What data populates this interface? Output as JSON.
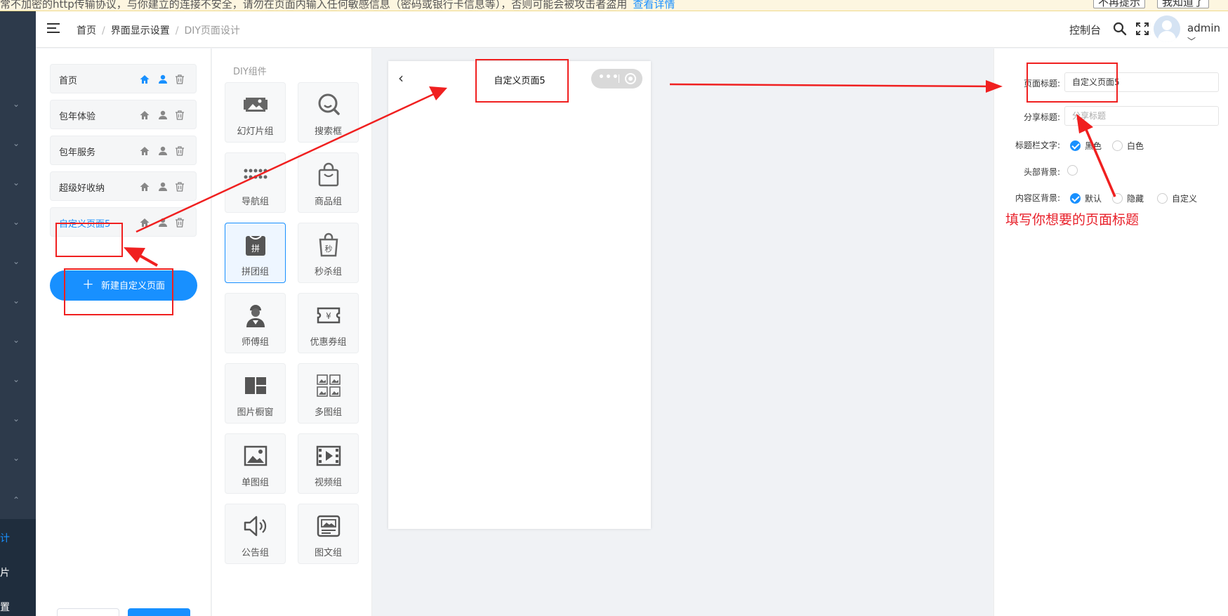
{
  "banner": {
    "text": "常不加密的http传输协议，与你建立的连接不安全，请勿在页面内输入任何敏感信息（密码或银行卡信息等），否则可能会被攻击者盗用",
    "link": "查看详情",
    "btn_no_remind": "不再提示",
    "btn_know": "我知道了"
  },
  "sidebar": {
    "items": [
      "计",
      "片",
      "置"
    ]
  },
  "header": {
    "breadcrumb": [
      "首页",
      "界面显示设置",
      "DIY页面设计"
    ],
    "console": "控制台",
    "user": "admin"
  },
  "pages": {
    "items": [
      {
        "label": "首页",
        "is_home": true
      },
      {
        "label": "包年体验",
        "is_home": false
      },
      {
        "label": "包年服务",
        "is_home": false
      },
      {
        "label": "超级好收纳",
        "is_home": false
      },
      {
        "label": "自定义页面5",
        "is_home": false
      }
    ],
    "new_button": "新建自定义页面"
  },
  "palette": {
    "title": "DIY组件",
    "components": [
      {
        "label": "幻灯片组",
        "icon": "slideshow-icon"
      },
      {
        "label": "搜索框",
        "icon": "search-icon"
      },
      {
        "label": "导航组",
        "icon": "nav-grid-icon"
      },
      {
        "label": "商品组",
        "icon": "shopping-bag-icon"
      },
      {
        "label": "拼团组",
        "icon": "group-buy-icon"
      },
      {
        "label": "秒杀组",
        "icon": "flash-sale-icon"
      },
      {
        "label": "师傅组",
        "icon": "worker-icon"
      },
      {
        "label": "优惠券组",
        "icon": "coupon-icon"
      },
      {
        "label": "图片橱窗",
        "icon": "image-window-icon"
      },
      {
        "label": "多图组",
        "icon": "multi-image-icon"
      },
      {
        "label": "单图组",
        "icon": "single-image-icon"
      },
      {
        "label": "视频组",
        "icon": "video-icon"
      },
      {
        "label": "公告组",
        "icon": "announcement-icon"
      },
      {
        "label": "图文组",
        "icon": "image-text-icon"
      }
    ]
  },
  "preview": {
    "title": "自定义页面5"
  },
  "settings": {
    "page_title_label": "页面标题:",
    "page_title_value": "自定义页面5",
    "share_title_label": "分享标题:",
    "share_title_placeholder": "分享标题",
    "titlebar_text_label": "标题栏文字:",
    "titlebar_options": [
      "黑色",
      "白色"
    ],
    "header_bg_label": "头部背景:",
    "content_bg_label": "内容区背景:",
    "content_bg_options": [
      "默认",
      "隐藏",
      "自定义"
    ]
  },
  "annotation": {
    "text": "填写你想要的页面标题",
    "color": "#e8202a"
  },
  "colors": {
    "primary": "#1890ff",
    "sidebar": "#2d3a4b"
  }
}
